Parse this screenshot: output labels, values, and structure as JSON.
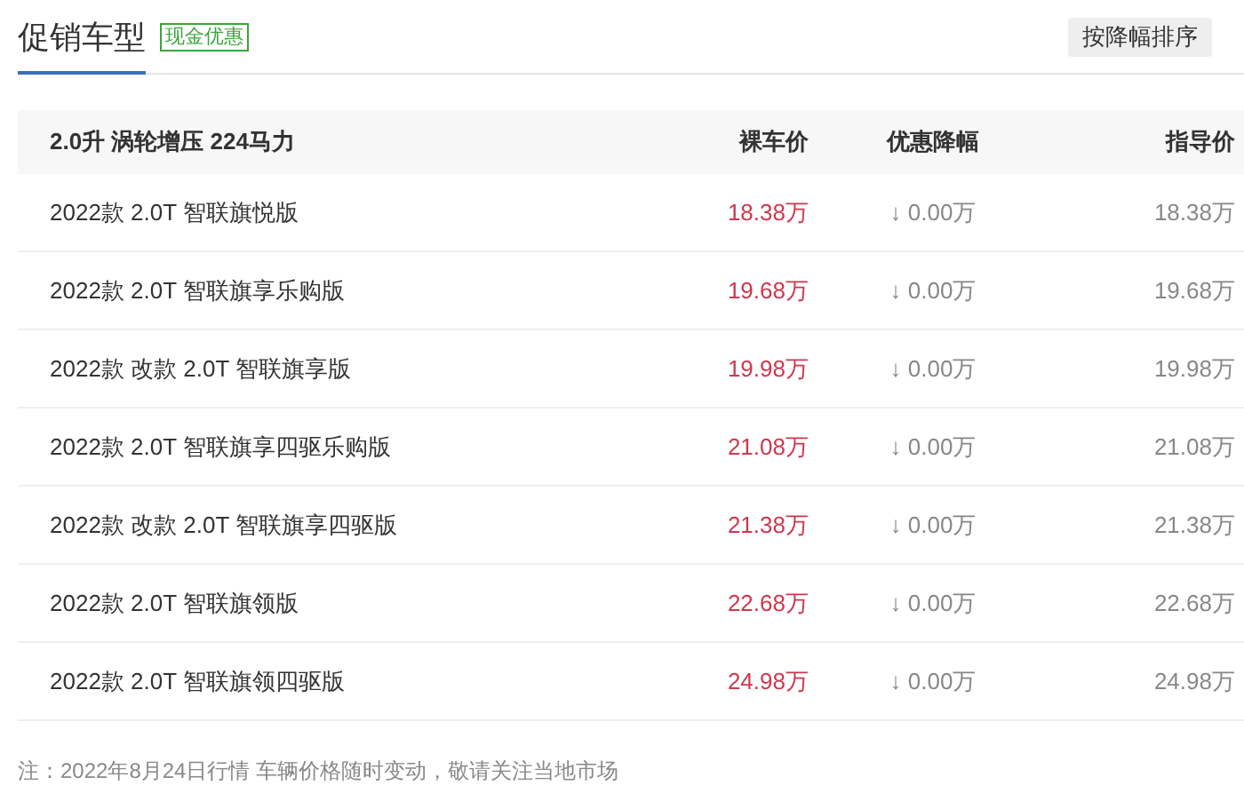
{
  "header": {
    "title": "促销车型",
    "badge": "现金优惠",
    "sort_button": "按降幅排序"
  },
  "table": {
    "group": "2.0升 涡轮增压 224马力",
    "columns": [
      "裸车价",
      "优惠降幅",
      "指导价"
    ],
    "rows": [
      {
        "name": "2022款 2.0T 智联旗悦版",
        "price": "18.38万",
        "discount": "↓ 0.00万",
        "guide": "18.38万"
      },
      {
        "name": "2022款 2.0T 智联旗享乐购版",
        "price": "19.68万",
        "discount": "↓ 0.00万",
        "guide": "19.68万"
      },
      {
        "name": "2022款 改款 2.0T 智联旗享版",
        "price": "19.98万",
        "discount": "↓ 0.00万",
        "guide": "19.98万"
      },
      {
        "name": "2022款 2.0T 智联旗享四驱乐购版",
        "price": "21.08万",
        "discount": "↓ 0.00万",
        "guide": "21.08万"
      },
      {
        "name": "2022款 改款 2.0T 智联旗享四驱版",
        "price": "21.38万",
        "discount": "↓ 0.00万",
        "guide": "21.38万"
      },
      {
        "name": "2022款 2.0T 智联旗领版",
        "price": "22.68万",
        "discount": "↓ 0.00万",
        "guide": "22.68万"
      },
      {
        "name": "2022款 2.0T 智联旗领四驱版",
        "price": "24.98万",
        "discount": "↓ 0.00万",
        "guide": "24.98万"
      }
    ]
  },
  "note": "注：2022年8月24日行情 车辆价格随时变动，敬请关注当地市场"
}
